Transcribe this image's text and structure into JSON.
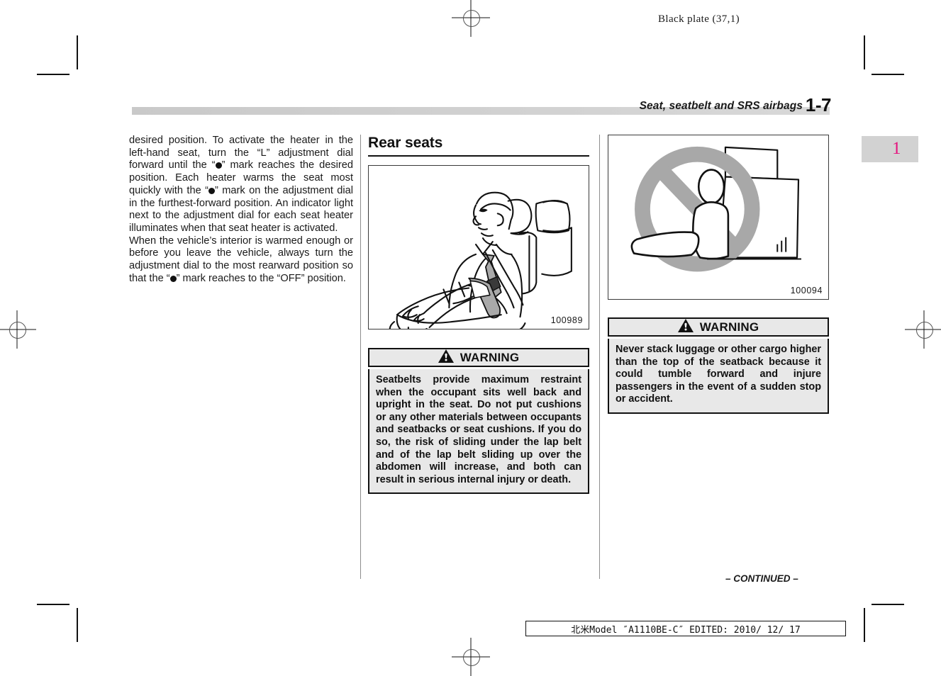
{
  "plate": {
    "label": "Black plate (37,1)"
  },
  "header": {
    "title": "Seat, seatbelt and SRS airbags",
    "page_number": "1-7",
    "chapter_tab": "1",
    "chapter_tab_color": "#e5127d",
    "band_color": "#c9c9c9"
  },
  "column_left": {
    "paragraphs": [
      {
        "segments": [
          {
            "type": "text",
            "value": "desired position. To activate the heater in the left-hand seat, turn the “L” adjustment dial forward until the “"
          },
          {
            "type": "dot"
          },
          {
            "type": "text",
            "value": "” mark reaches the desired position. Each heater warms the seat most quickly with the “"
          },
          {
            "type": "dot"
          },
          {
            "type": "text",
            "value": "” mark on the adjustment dial in the furthest-forward position. An indicator light next to the adjustment dial for each seat heater illuminates when that seat heater is activated."
          }
        ]
      },
      {
        "segments": [
          {
            "type": "text",
            "value": "When the vehicle’s interior is warmed enough or before you leave the vehicle, always turn the adjustment dial to the most rearward position so that the “"
          },
          {
            "type": "dot"
          },
          {
            "type": "text",
            "value": "” mark reaches to the “OFF” position."
          }
        ]
      }
    ]
  },
  "column_middle": {
    "heading": "Rear seats",
    "figure": {
      "caption": "100989",
      "alt": "Occupant seated well back and upright in a rear seat wearing a seatbelt"
    },
    "warning": {
      "title": "WARNING",
      "icon": "warning-triangle-icon",
      "text": "Seatbelts provide maximum restraint when the occupant sits well back and upright in the seat. Do not put cushions or any other materials between occupants and seatbacks or seat cushions. If you do so, the risk of sliding under the lap belt and of the lap belt sliding up over the abdomen will increase, and both can result in serious internal injury or death."
    }
  },
  "column_right": {
    "figure": {
      "caption": "100094",
      "alt": "Prohibition symbol over luggage stacked higher than the seatback"
    },
    "warning": {
      "title": "WARNING",
      "icon": "warning-triangle-icon",
      "text": "Never stack luggage or other cargo higher than the top of the seatback because it could tumble forward and injure passengers in the event of a sudden stop or accident."
    }
  },
  "footer": {
    "continued": "– CONTINUED –",
    "stamp": "北米Model ″A1110BE-C″ EDITED: 2010/ 12/ 17"
  }
}
